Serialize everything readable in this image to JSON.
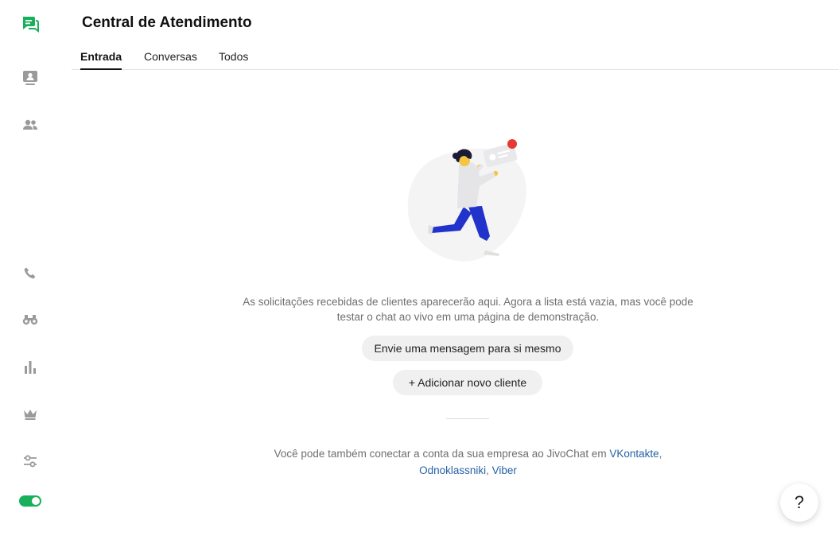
{
  "header": {
    "title": "Central de Atendimento",
    "tabs": [
      {
        "label": "Entrada",
        "active": true
      },
      {
        "label": "Conversas",
        "active": false
      },
      {
        "label": "Todos",
        "active": false
      }
    ]
  },
  "sidebar": {
    "items": [
      {
        "icon": "chat-icon",
        "active": true
      },
      {
        "icon": "contacts-card-icon"
      },
      {
        "icon": "team-icon"
      },
      {
        "icon": "phone-icon"
      },
      {
        "icon": "binoculars-icon"
      },
      {
        "icon": "bar-chart-icon"
      },
      {
        "icon": "crown-icon"
      },
      {
        "icon": "sliders-icon"
      }
    ],
    "status_toggle": {
      "on": true,
      "color": "#18b05a"
    }
  },
  "empty_state": {
    "description": "As solicitações recebidas de clientes aparecerão aqui. Agora a lista está vazia, mas você pode testar o chat ao vivo em uma página de demonstração.",
    "send_self_button": "Envie uma mensagem para si mesmo",
    "add_client_button": "+ Adicionar novo cliente",
    "connect_text": "Você pode também conectar a conta da sua empresa ao JivoChat em",
    "links": {
      "vkontakte": "VKontakte",
      "odnoklassniki": "Odnoklassniki",
      "viber": "Viber"
    },
    "comma": ",",
    "comma_space": ", "
  },
  "help": {
    "label": "?"
  },
  "colors": {
    "accent_green": "#18b05a",
    "link_blue": "#2762a6",
    "icon_gray": "#9a9a9a",
    "figure_blue": "#2233cc"
  }
}
